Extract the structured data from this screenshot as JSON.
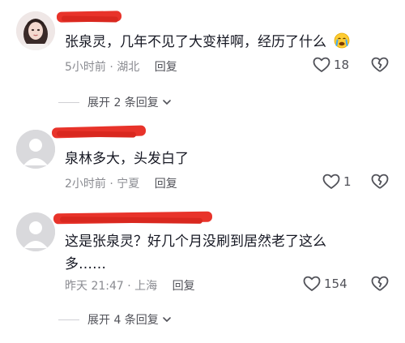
{
  "comments": [
    {
      "text": "张泉灵，几年不见了大变样啊，经历了什么",
      "emoji": "😭",
      "time_location": "5小时前 · 湖北",
      "reply_label": "回复",
      "likes": "18"
    },
    {
      "text": "泉林多大，头发白了",
      "time_location": "2小时前 · 宁夏",
      "reply_label": "回复",
      "likes": "1"
    },
    {
      "text_line1": "这是张泉灵？好几个月没刷到居然老了这么",
      "text_line2": "多……",
      "time_location": "昨天 21:47 · 上海",
      "reply_label": "回复",
      "likes": "154"
    }
  ],
  "expanders": [
    {
      "label": "展开 2 条回复"
    },
    {
      "label": "展开 4 条回复"
    }
  ],
  "colors": {
    "redaction": "#e8332a",
    "meta_gray": "#8a8b91",
    "text": "#161823"
  },
  "icons": [
    "heart-outline-icon",
    "broken-heart-icon",
    "chevron-down-icon",
    "default-avatar-icon",
    "crying-emoji-icon"
  ]
}
